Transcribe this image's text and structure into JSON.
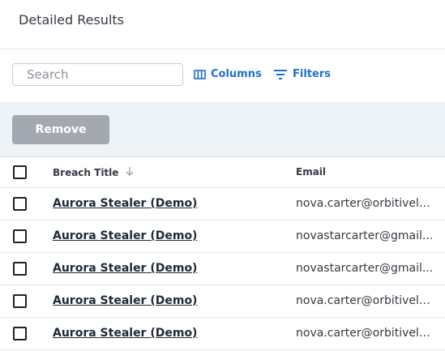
{
  "header": {
    "title": "Detailed Results"
  },
  "toolbar": {
    "search_placeholder": "Search",
    "columns_label": "Columns",
    "filters_label": "Filters"
  },
  "actions": {
    "remove_label": "Remove"
  },
  "table": {
    "columns": {
      "breach_title": "Breach Title",
      "email": "Email"
    },
    "rows": [
      {
        "breach_title": "Aurora Stealer (Demo)",
        "email": "nova.carter@orbitivela..."
      },
      {
        "breach_title": "Aurora Stealer (Demo)",
        "email": "novastarcarter@gmail..."
      },
      {
        "breach_title": "Aurora Stealer (Demo)",
        "email": "novastarcarter@gmail..."
      },
      {
        "breach_title": "Aurora Stealer (Demo)",
        "email": "nova.carter@orbitivela..."
      },
      {
        "breach_title": "Aurora Stealer (Demo)",
        "email": "nova.carter@orbitivela..."
      }
    ]
  },
  "colors": {
    "accent": "#1f6fd0",
    "disabled_button": "#a4a9b1",
    "action_bar": "#eef3f7"
  },
  "icons": {
    "columns": "columns-icon",
    "filters": "filter-icon",
    "sort": "arrow-down-icon"
  }
}
